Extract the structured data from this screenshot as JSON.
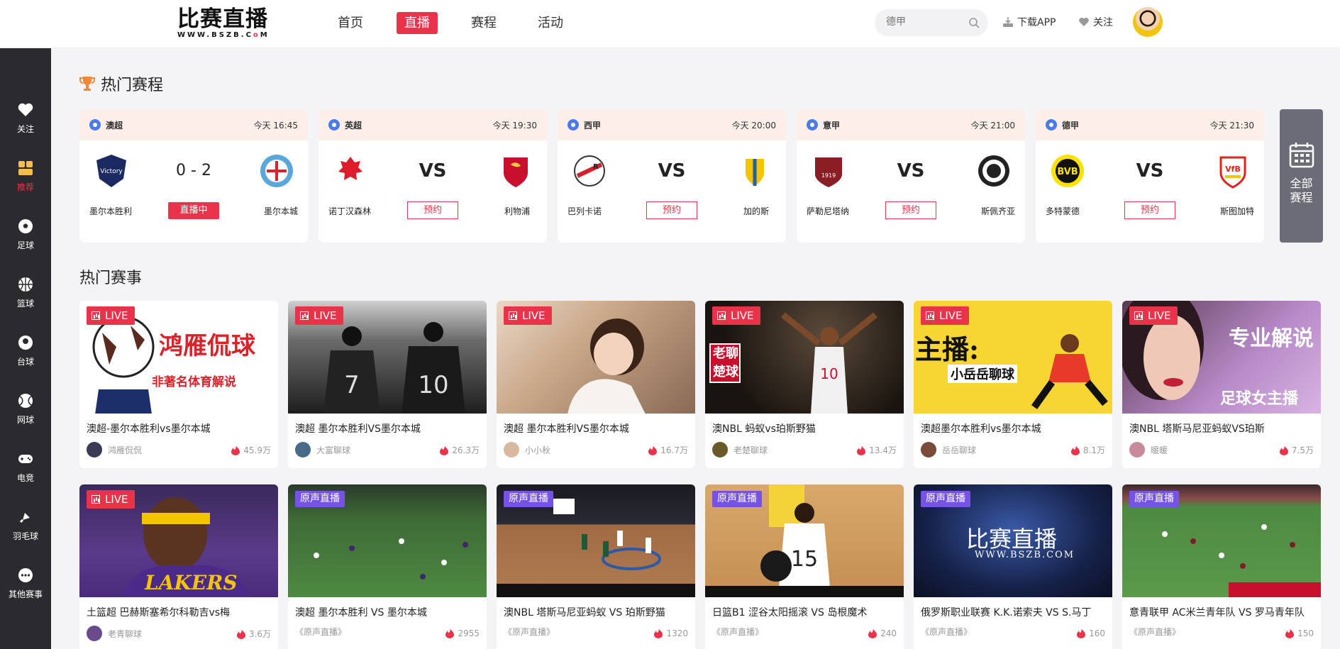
{
  "header": {
    "logo_main": "比赛直播",
    "logo_sub_a": "WWW.BSZB.C",
    "logo_sub_b": "o",
    "logo_sub_c": "M",
    "nav": [
      {
        "label": "首页"
      },
      {
        "label": "直播",
        "active": true
      },
      {
        "label": "赛程"
      },
      {
        "label": "活动"
      }
    ],
    "search_placeholder": "德甲",
    "download_label": "下载APP",
    "follow_label": "关注"
  },
  "sidebar": {
    "items": [
      {
        "label": "关注",
        "icon": "heart-icon"
      },
      {
        "label": "推荐",
        "icon": "grid-icon",
        "active": true
      },
      {
        "label": "足球",
        "icon": "soccer-ball-icon"
      },
      {
        "label": "篮球",
        "icon": "basketball-icon"
      },
      {
        "label": "台球",
        "icon": "billiard-icon"
      },
      {
        "label": "网球",
        "icon": "tennis-icon"
      },
      {
        "label": "电竞",
        "icon": "gamepad-icon"
      },
      {
        "label": "羽毛球",
        "icon": "shuttlecock-icon"
      },
      {
        "label": "其他赛事",
        "icon": "more-icon"
      }
    ]
  },
  "schedule": {
    "title": "热门赛程",
    "all_label_1": "全部",
    "all_label_2": "赛程",
    "matches": [
      {
        "league": "澳超",
        "time": "今天 16:45",
        "home": "墨尔本胜利",
        "away": "墨尔本城",
        "score": "0 - 2",
        "status": "直播中",
        "home_color": "#1c2a63",
        "away_color": "#5aa7dc"
      },
      {
        "league": "英超",
        "time": "今天 19:30",
        "home": "诺丁汉森林",
        "away": "利物浦",
        "vs": "VS",
        "status": "预约",
        "home_color": "#dd1b2a",
        "away_color": "#c8102e"
      },
      {
        "league": "西甲",
        "time": "今天 20:00",
        "home": "巴列卡诺",
        "away": "加的斯",
        "vs": "VS",
        "status": "预约",
        "home_color": "#d6202a",
        "away_color": "#f3c400"
      },
      {
        "league": "意甲",
        "time": "今天 21:00",
        "home": "萨勒尼塔纳",
        "away": "斯佩齐亚",
        "vs": "VS",
        "status": "预约",
        "home_color": "#8b1e24",
        "away_color": "#222222"
      },
      {
        "league": "德甲",
        "time": "今天 21:30",
        "home": "多特蒙德",
        "away": "斯图加特",
        "vs": "VS",
        "status": "预约",
        "home_color": "#fde100",
        "away_color": "#e32219"
      }
    ]
  },
  "events": {
    "title": "热门赛事",
    "cards": [
      {
        "badge": "LIVE",
        "title": "澳超-墨尔本胜利vs墨尔本城",
        "user": "鸿雁侃侃",
        "hot": "45.9万",
        "overlay1": "鸿雁侃球",
        "overlay2": "非著名体育解说"
      },
      {
        "badge": "LIVE",
        "title": "澳超 墨尔本胜利VS墨尔本城",
        "user": "大富聊球",
        "hot": "26.3万"
      },
      {
        "badge": "LIVE",
        "title": "澳超 墨尔本胜利VS墨尔本城",
        "user": "小小秋",
        "hot": "16.7万"
      },
      {
        "badge": "LIVE",
        "title": "澳NBL 蚂蚁vs珀斯野猫",
        "user": "老楚聊球",
        "hot": "13.4万",
        "overlay1": "老聊",
        "overlay2": "楚球"
      },
      {
        "badge": "LIVE",
        "title": "澳超墨尔本胜利vs墨尔本城",
        "user": "岳岳聊球",
        "hot": "8.1万",
        "overlay1": "主播:",
        "overlay2": "小岳岳聊球"
      },
      {
        "badge": "LIVE",
        "title": "澳NBL 塔斯马尼亚蚂蚁VS珀斯",
        "user": "暖暖",
        "hot": "7.5万",
        "overlay1": "专业解说",
        "overlay2": "足球女主播"
      },
      {
        "badge": "LIVE",
        "title": "土篮超 巴赫斯塞希尔科勒吉vs梅",
        "user": "老青聊球",
        "hot": "3.6万",
        "overlay1": "LAKERS"
      },
      {
        "badge": "原声直播",
        "title": "澳超 墨尔本胜利 VS 墨尔本城",
        "user": "《原声直播》",
        "hot": "2955"
      },
      {
        "badge": "原声直播",
        "title": "澳NBL 塔斯马尼亚蚂蚁 VS 珀斯野猫",
        "user": "《原声直播》",
        "hot": "1320"
      },
      {
        "badge": "原声直播",
        "title": "日篮B1 涩谷太阳摇滚 VS 岛根魔术",
        "user": "《原声直播》",
        "hot": "240"
      },
      {
        "badge": "原声直播",
        "title": "俄罗斯职业联赛 K.K.诺索夫 VS S.马丁",
        "user": "《原声直播》",
        "hot": "160",
        "overlay1": "比赛直播",
        "overlay2": "WWW.BSZB.COM"
      },
      {
        "badge": "原声直播",
        "title": "意青联甲 AC米兰青年队 VS 罗马青年队",
        "user": "《原声直播》",
        "hot": "150"
      }
    ]
  },
  "colors": {
    "accent": "#e8334a",
    "sidebar_bg": "#2b2b2f",
    "original_badge": "#7653e6"
  }
}
